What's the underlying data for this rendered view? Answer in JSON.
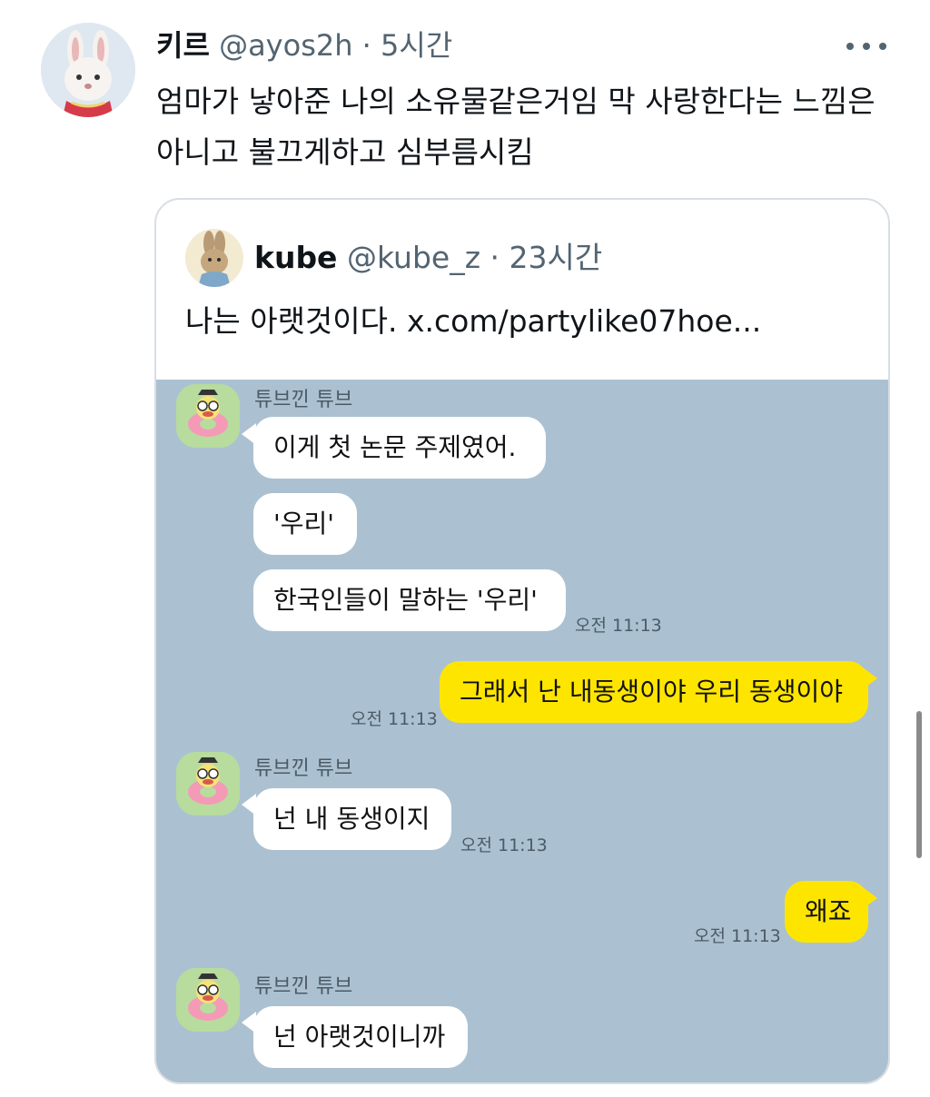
{
  "tweet": {
    "author_name": "키르",
    "handle": "@ayos2h",
    "separator": "·",
    "time": "5시간",
    "text": "엄마가 낳아준 나의 소유물같은거임 막 사랑한다는 느낌은 아니고 불끄게하고 심부름시킴",
    "more_icon": "more-horizontal-icon",
    "avatar_icon": "bunny-figurine-avatar"
  },
  "quote": {
    "author_name": "kube",
    "handle": "@kube_z",
    "separator": "·",
    "time": "23시간",
    "text": "나는 아랫것이다.  x.com/partylike07hoe...",
    "avatar_icon": "rabbit-avatar"
  },
  "chat": {
    "background": "#abc1d1",
    "in_bubble_color": "#ffffff",
    "out_bubble_color": "#fee500",
    "sender_name": "튜브낀 튜브",
    "messages": [
      {
        "dir": "in",
        "text": "이게 첫 논문 주제였어."
      },
      {
        "dir": "in",
        "text": "'우리'"
      },
      {
        "dir": "in",
        "text": "한국인들이 말하는 '우리'",
        "time": "오전 11:13"
      },
      {
        "dir": "out",
        "text": "그래서 난 내동생이야 우리 동생이야",
        "time": "오전 11:13"
      },
      {
        "dir": "in",
        "text": "넌 내 동생이지",
        "time": "오전 11:13"
      },
      {
        "dir": "out",
        "text": "왜죠",
        "time": "오전 11:13"
      },
      {
        "dir": "in",
        "text": "넌 아랫것이니까"
      }
    ]
  }
}
